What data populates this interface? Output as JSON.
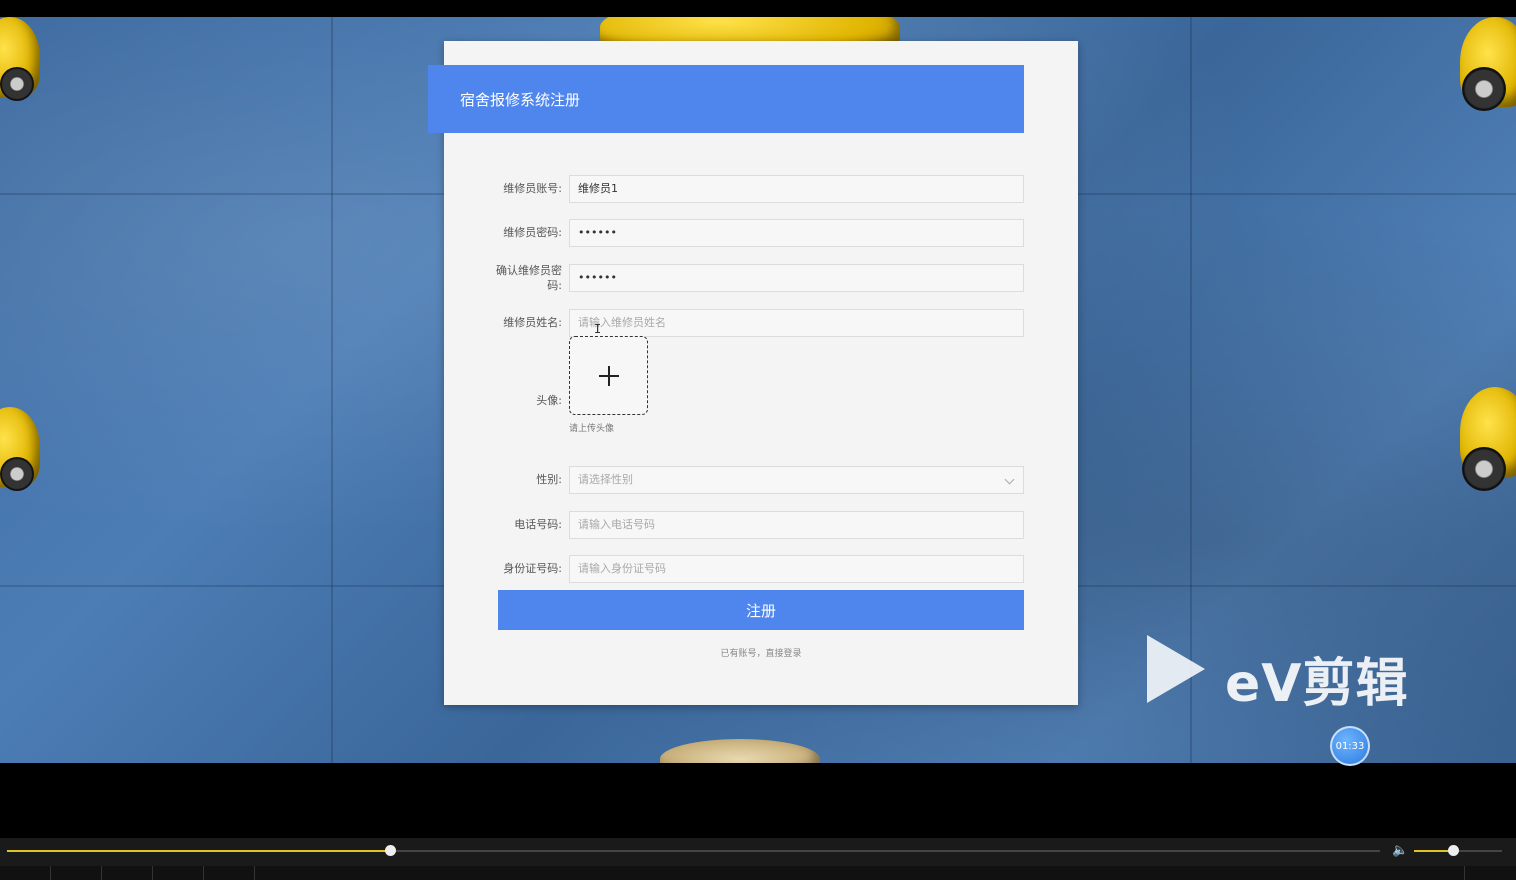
{
  "form": {
    "title": "宿舍报修系统注册",
    "fields": [
      {
        "label": "维修员账号:",
        "value": "维修员1",
        "placeholder": ""
      },
      {
        "label": "维修员密码:",
        "value": "••••••",
        "placeholder": ""
      },
      {
        "label": "确认维修员密码:",
        "value": "••••••",
        "placeholder": ""
      },
      {
        "label": "维修员姓名:",
        "value": "",
        "placeholder": "请输入维修员姓名"
      }
    ],
    "avatar": {
      "label": "头像:",
      "hint": "请上传头像"
    },
    "gender": {
      "label": "性别:",
      "placeholder": "请选择性别"
    },
    "phone": {
      "label": "电话号码:",
      "placeholder": "请输入电话号码"
    },
    "idcard": {
      "label": "身份证号码:",
      "placeholder": "请输入身份证号码"
    },
    "submit_label": "注册",
    "login_link": "已有账号，直接登录"
  },
  "watermark": {
    "text": "eV剪辑"
  },
  "player": {
    "timer": "01:33",
    "progress": 0.279,
    "volume": 0.44
  },
  "colors": {
    "accent": "#4e86ee",
    "progress": "#e0c220"
  }
}
